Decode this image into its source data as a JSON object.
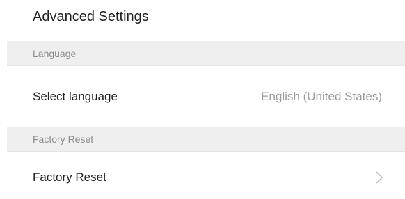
{
  "header": {
    "title": "Advanced Settings"
  },
  "sections": [
    {
      "header": "Language",
      "row": {
        "label": "Select language",
        "value": "English (United States)"
      }
    },
    {
      "header": "Factory Reset",
      "row": {
        "label": "Factory Reset",
        "icon": "chevron-right-icon"
      }
    }
  ],
  "colors": {
    "section_background": "#efefef",
    "label_text": "#222222",
    "secondary_text": "#9a9a9a"
  }
}
